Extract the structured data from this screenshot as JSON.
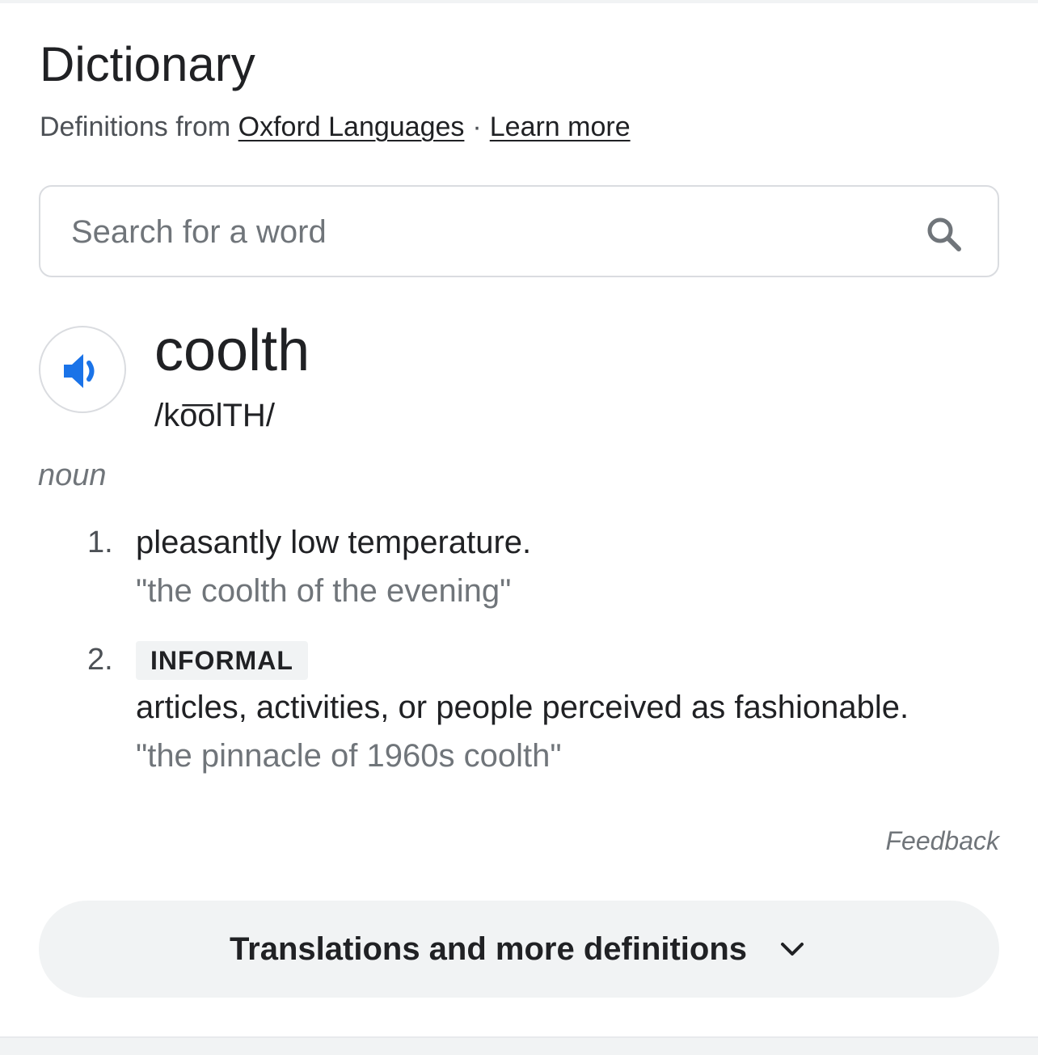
{
  "header": {
    "title": "Dictionary",
    "source_prefix": "Definitions from",
    "source_link": "Oxford Languages",
    "separator": "·",
    "learn_more": "Learn more"
  },
  "search": {
    "placeholder": "Search for a word",
    "value": "",
    "icon": "search-icon"
  },
  "entry": {
    "word": "coolth",
    "phonetic": "/ko͞olTH/",
    "audio_icon": "speaker-icon",
    "part_of_speech": "noun",
    "definitions": [
      {
        "number": "1.",
        "text": "pleasantly low temperature.",
        "example": "\"the coolth of the evening\""
      },
      {
        "number": "2.",
        "register": "INFORMAL",
        "text": "articles, activities, or people perceived as fashionable.",
        "example": "\"the pinnacle of 1960s coolth\""
      }
    ]
  },
  "feedback_label": "Feedback",
  "more_button": {
    "label": "Translations and more definitions",
    "icon": "chevron-down-icon"
  },
  "colors": {
    "accent_blue": "#1a73e8",
    "text_primary": "#202124",
    "text_secondary": "#70757a",
    "chip_bg": "#f1f3f4",
    "border": "#dadce0"
  }
}
